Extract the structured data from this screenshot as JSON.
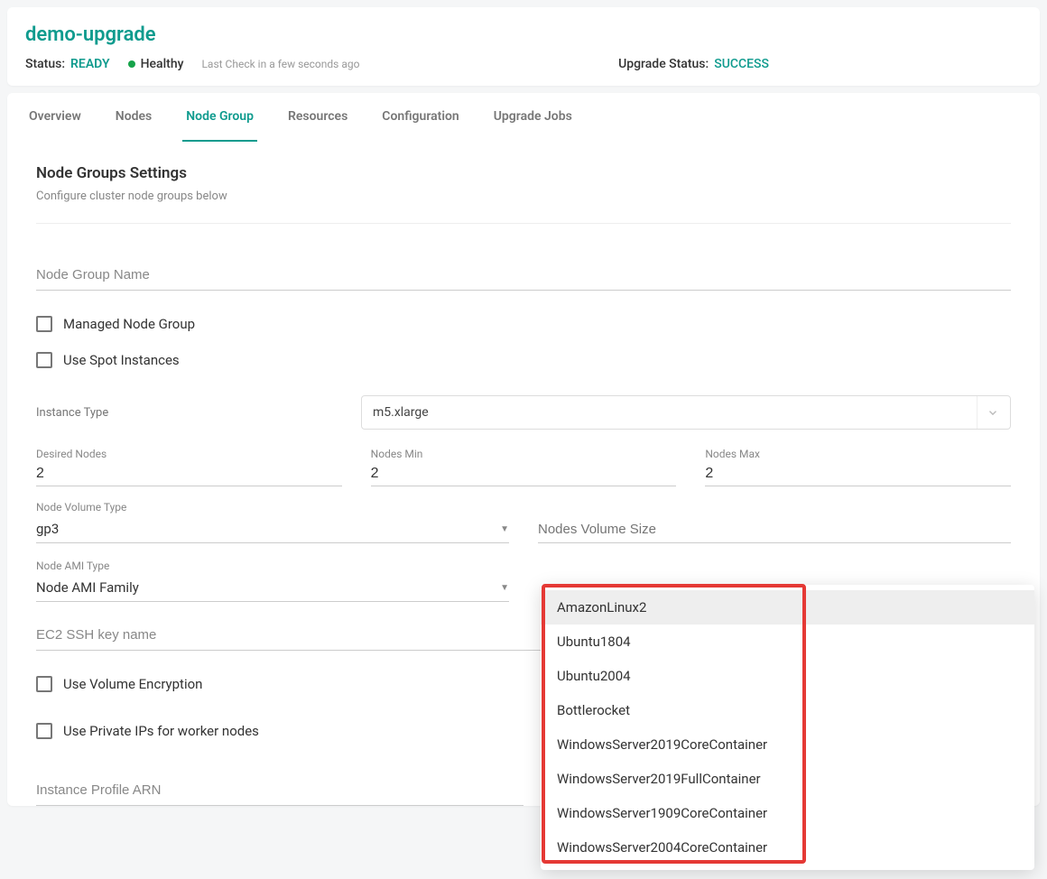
{
  "header": {
    "title": "demo-upgrade",
    "status_label": "Status:",
    "status_value": "READY",
    "healthy_text": "Healthy",
    "last_check": "Last Check in a few seconds ago",
    "upgrade_status_label": "Upgrade Status:",
    "upgrade_status_value": "SUCCESS"
  },
  "tabs": {
    "overview": "Overview",
    "nodes": "Nodes",
    "node_group": "Node Group",
    "resources": "Resources",
    "configuration": "Configuration",
    "upgrade_jobs": "Upgrade Jobs"
  },
  "settings": {
    "title": "Node Groups Settings",
    "desc": "Configure cluster node groups below"
  },
  "form": {
    "node_group_name_placeholder": "Node Group Name",
    "managed_node_group": "Managed Node Group",
    "use_spot_instances": "Use Spot Instances",
    "instance_type_label": "Instance Type",
    "instance_type_value": "m5.xlarge",
    "desired_nodes_label": "Desired Nodes",
    "desired_nodes_value": "2",
    "nodes_min_label": "Nodes Min",
    "nodes_min_value": "2",
    "nodes_max_label": "Nodes Max",
    "nodes_max_value": "2",
    "node_volume_type_label": "Node Volume Type",
    "node_volume_type_value": "gp3",
    "nodes_volume_size_placeholder": "Nodes Volume Size",
    "node_ami_type_label": "Node AMI Type",
    "node_ami_family_value": "Node AMI Family",
    "ec2_ssh_placeholder": "EC2 SSH key name",
    "use_volume_encryption": "Use Volume Encryption",
    "use_private_ips": "Use Private IPs for worker nodes",
    "instance_profile_arn_placeholder": "Instance Profile ARN"
  },
  "dropdown": {
    "options": [
      "AmazonLinux2",
      "Ubuntu1804",
      "Ubuntu2004",
      "Bottlerocket",
      "WindowsServer2019CoreContainer",
      "WindowsServer2019FullContainer",
      "WindowsServer1909CoreContainer",
      "WindowsServer2004CoreContainer"
    ]
  }
}
